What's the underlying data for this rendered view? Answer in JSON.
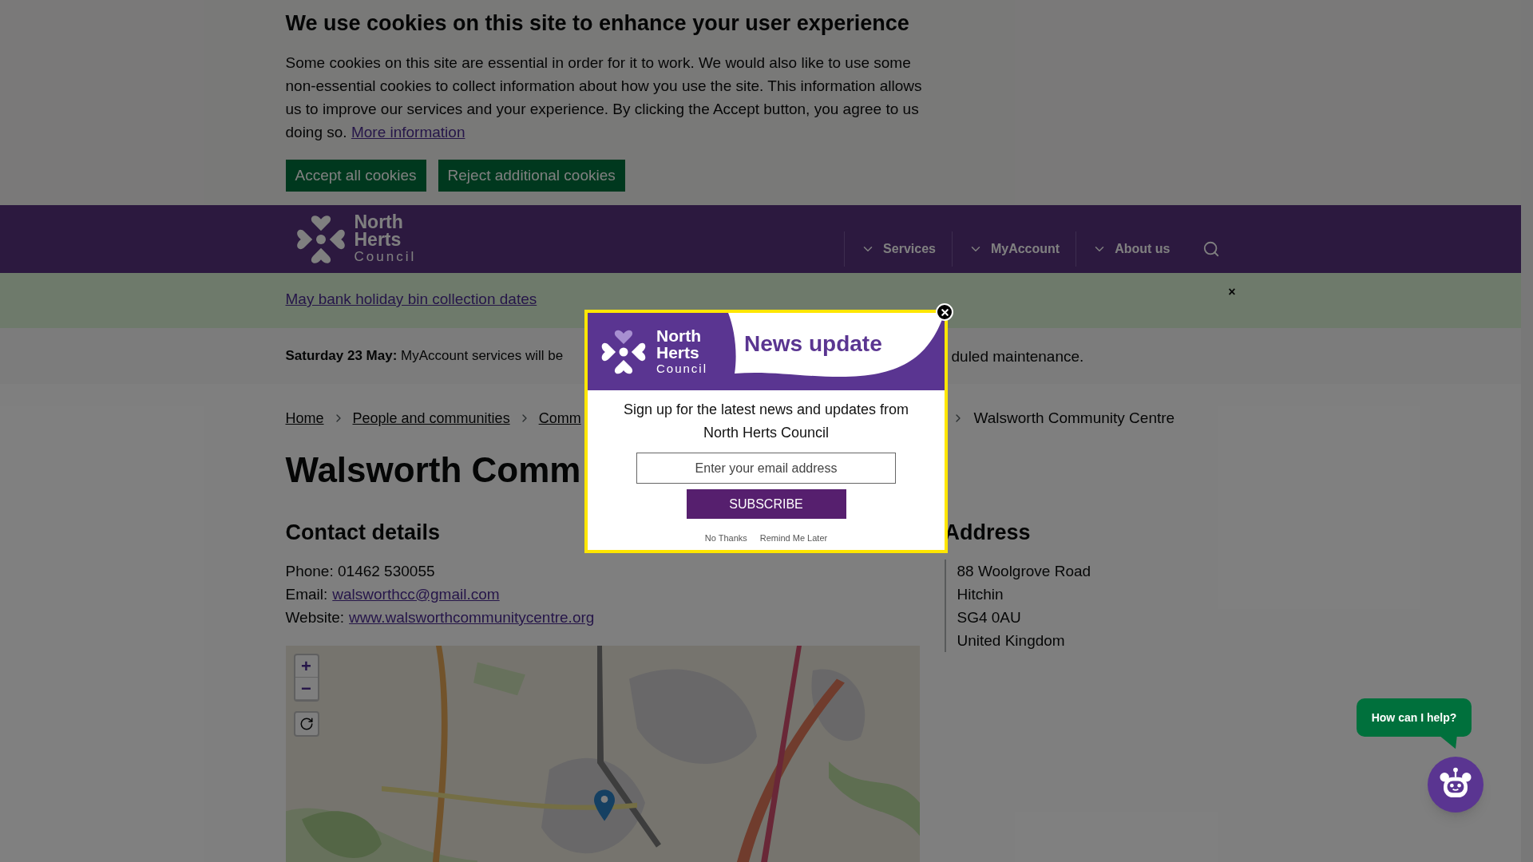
{
  "cookie_banner": {
    "title": "We use cookies on this site to enhance your user experience",
    "text": "Some cookies on this site are essential in order for it to work. We would also like to use some non-essential cookies to collect information about how you use the site. This information allows us to improve our services and your experience. By clicking the Accept button, you agree to us doing so.",
    "link": "More information",
    "buttons": [
      "Accept all cookies",
      "Reject additional cookies"
    ]
  },
  "header": {
    "logo": [
      "North",
      "Herts",
      "Council"
    ],
    "nav": [
      {
        "label": "Services",
        "kind": "dropdown"
      },
      {
        "label": "MyAccount",
        "kind": "dropdown"
      },
      {
        "label": "About us",
        "kind": "dropdown"
      },
      {
        "kind": "search"
      }
    ]
  },
  "alert": {
    "link": "May bank holiday bin collection dates",
    "close": "×"
  },
  "notice": {
    "text": "**Saturday 23 May:** MyAccount services will be",
    "text_after": "duled maintenance."
  },
  "breadcrumb": {
    "items": [
      "Home",
      "People and communities",
      "Comm"
    ],
    "current": "Walsworth Community Centre"
  },
  "page_title": "Walsworth Comm",
  "contact": {
    "title": "Contact details",
    "phone": "Phone: 01462 530055",
    "email_label": "Email:",
    "email": "walsworthcc@gmail.com",
    "website_label": "Website:",
    "website": "www.walsworthcommunitycentre.org"
  },
  "address": {
    "title": "Address",
    "lines": [
      "88 Woolgrove Road",
      "Hitchin",
      "SG4 0AU",
      "United Kingdom"
    ]
  },
  "map": {
    "controls": [
      {
        "label": "+",
        "kind": "zoom"
      },
      {
        "label": "−",
        "kind": "zoom"
      },
      {
        "kind": "reset"
      }
    ]
  },
  "popup": {
    "logo": [
      "North",
      "Herts",
      "Council"
    ],
    "title": "News update",
    "text": "Sign up for the latest news and updates from North Herts Council",
    "placeholder": "Enter your email address",
    "button": "SUBSCRIBE",
    "links": [
      "No Thanks",
      "Remind Me Later"
    ]
  },
  "chat": {
    "bubble": "How can I help?"
  }
}
